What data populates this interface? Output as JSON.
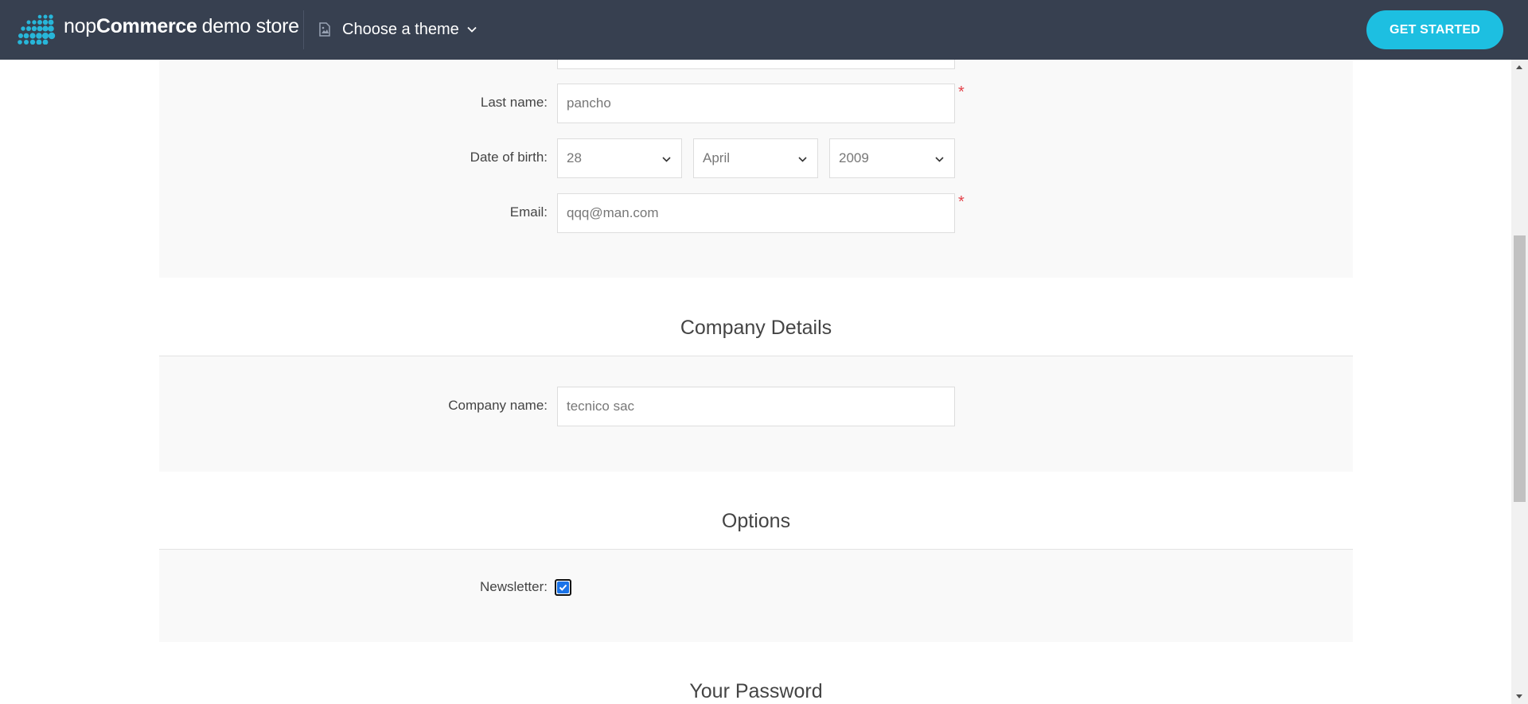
{
  "header": {
    "brand_nop": "nop",
    "brand_commerce": "Commerce",
    "brand_demo": "demo store",
    "theme_label": "Choose a theme",
    "cta_label": "GET STARTED"
  },
  "personal": {
    "last_name_label": "Last name:",
    "last_name_value": "pancho",
    "dob_label": "Date of birth:",
    "dob_day": "28",
    "dob_month": "April",
    "dob_year": "2009",
    "email_label": "Email:",
    "email_value": "qqq@man.com",
    "required_mark": "*"
  },
  "company": {
    "title": "Company Details",
    "name_label": "Company name:",
    "name_value": "tecnico sac"
  },
  "options": {
    "title": "Options",
    "newsletter_label": "Newsletter:",
    "newsletter_checked": true
  },
  "password": {
    "title": "Your Password"
  },
  "colors": {
    "topbar": "#374050",
    "accent": "#1dbfe1",
    "required": "#e4434b",
    "panel": "#f9f9f9"
  }
}
